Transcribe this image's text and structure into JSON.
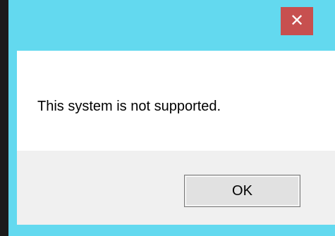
{
  "dialog": {
    "close_glyph": "✕",
    "message": "This system is not supported.",
    "ok_label": "OK"
  },
  "colors": {
    "frame": "#63d9ef",
    "close_button": "#c7504f",
    "button_bar": "#f0f0f0",
    "background": "#1b1b1b"
  },
  "icons": {
    "close": "close-icon"
  }
}
